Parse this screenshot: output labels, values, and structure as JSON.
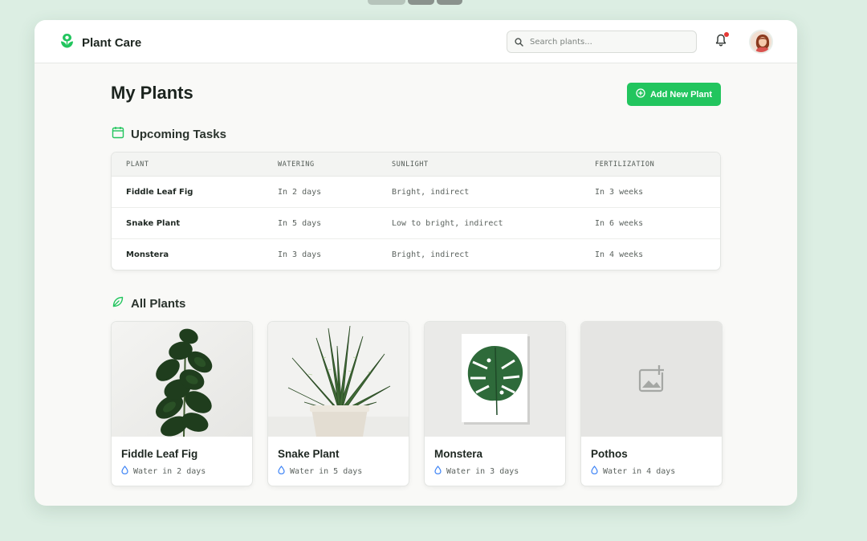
{
  "app": {
    "name": "Plant Care"
  },
  "header": {
    "search_placeholder": "Search plants..."
  },
  "page": {
    "title": "My Plants",
    "add_button_label": "Add New Plant"
  },
  "tasks": {
    "title": "Upcoming Tasks",
    "columns": [
      "PLANT",
      "WATERING",
      "SUNLIGHT",
      "FERTILIZATION"
    ],
    "rows": [
      {
        "plant": "Fiddle Leaf Fig",
        "watering": "In 2 days",
        "sunlight": "Bright, indirect",
        "fertilization": "In 3 weeks"
      },
      {
        "plant": "Snake Plant",
        "watering": "In 5 days",
        "sunlight": "Low to bright, indirect",
        "fertilization": "In 6 weeks"
      },
      {
        "plant": "Monstera",
        "watering": "In 3 days",
        "sunlight": "Bright, indirect",
        "fertilization": "In 4 weeks"
      }
    ]
  },
  "plants": {
    "title": "All Plants",
    "items": [
      {
        "name": "Fiddle Leaf Fig",
        "water": "Water in 2 days",
        "image": "fiddle-leaf-fig-photo"
      },
      {
        "name": "Snake Plant",
        "water": "Water in 5 days",
        "image": "snake-plant-photo"
      },
      {
        "name": "Monstera",
        "water": "Water in 3 days",
        "image": "monstera-leaf-print"
      },
      {
        "name": "Pothos",
        "water": "Water in 4 days",
        "image": "image-placeholder"
      }
    ]
  },
  "colors": {
    "accent": "#22c55e",
    "background": "#dceee3",
    "notification_dot": "#e53935",
    "water_icon": "#3b82f6"
  }
}
